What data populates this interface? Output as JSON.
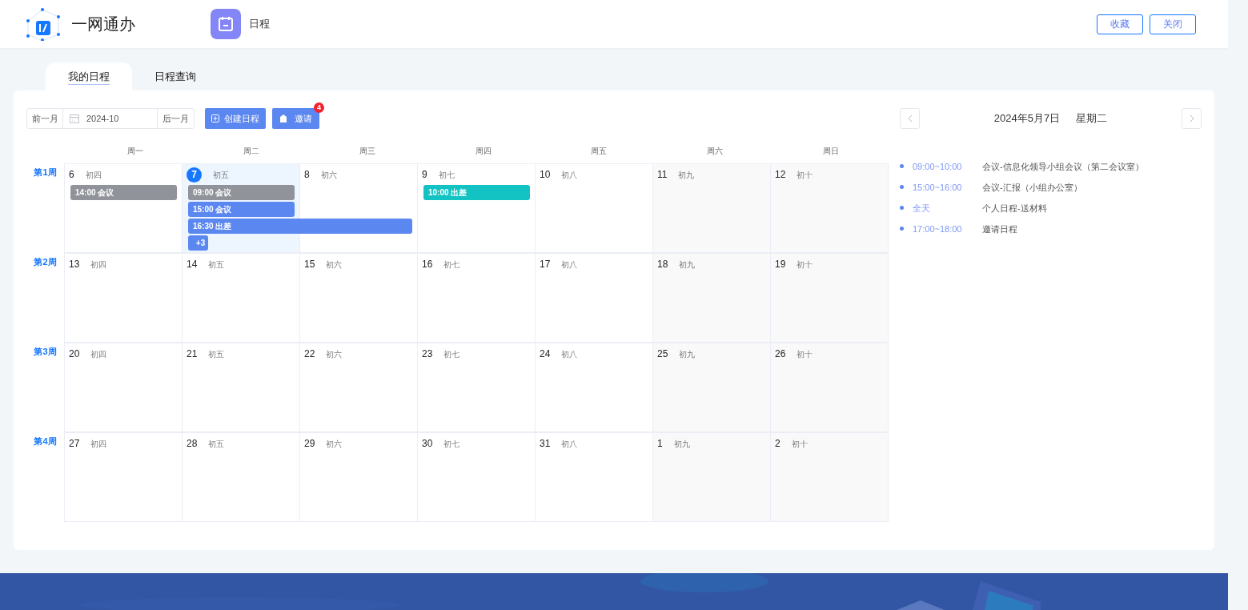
{
  "header": {
    "app_name": "一网通办",
    "module": "日程",
    "buttons": [
      "收藏",
      "关闭"
    ]
  },
  "tabs": [
    {
      "label": "我的日程",
      "selected": true
    },
    {
      "label": "日程查询",
      "selected": false
    }
  ],
  "toolbar": {
    "prev": "前一月",
    "month": "2024-10",
    "next": "后一月",
    "create": "创建日程",
    "invite": "邀请",
    "invite_badge": "4"
  },
  "weekdays": [
    "周一",
    "周二",
    "周三",
    "周四",
    "周五",
    "周六",
    "周日"
  ],
  "weeks": [
    {
      "label": "第1周",
      "days": [
        {
          "date": "6",
          "lunar": "初四",
          "selected": false,
          "events": [
            {
              "kind": "event",
              "label": "14:00 会议",
              "color": "#909399"
            }
          ]
        },
        {
          "date": "7",
          "lunar": "初五",
          "selected": true,
          "events": [
            {
              "kind": "event",
              "label": "09:00 会议",
              "color": "#909399"
            },
            {
              "kind": "event",
              "label": "15:00 会议",
              "color": "#5b87f0"
            },
            {
              "kind": "event",
              "label": "16:30 出差",
              "color": "#5b87f0",
              "continues": true
            },
            {
              "kind": "more",
              "label": "+3",
              "color": "#5b87f0"
            }
          ]
        },
        {
          "date": "8",
          "lunar": "初六",
          "selected": false
        },
        {
          "date": "9",
          "lunar": "初七",
          "selected": false,
          "events": [
            {
              "kind": "event",
              "label": "10:00 出差",
              "color": "#13c2c2"
            }
          ]
        },
        {
          "date": "10",
          "lunar": "初八",
          "selected": false
        },
        {
          "date": "11",
          "lunar": "初九",
          "selected": false
        },
        {
          "date": "12",
          "lunar": "初十",
          "selected": false
        }
      ]
    },
    {
      "label": "第2周",
      "days": [
        {
          "date": "13",
          "lunar": "初四",
          "selected": false
        },
        {
          "date": "14",
          "lunar": "初五",
          "selected": false
        },
        {
          "date": "15",
          "lunar": "初六",
          "selected": false
        },
        {
          "date": "16",
          "lunar": "初七",
          "selected": false
        },
        {
          "date": "17",
          "lunar": "初八",
          "selected": false
        },
        {
          "date": "18",
          "lunar": "初九",
          "selected": false
        },
        {
          "date": "19",
          "lunar": "初十",
          "selected": false
        }
      ]
    },
    {
      "label": "第3周",
      "days": [
        {
          "date": "20",
          "lunar": "初四",
          "selected": false
        },
        {
          "date": "21",
          "lunar": "初五",
          "selected": false
        },
        {
          "date": "22",
          "lunar": "初六",
          "selected": false
        },
        {
          "date": "23",
          "lunar": "初七",
          "selected": false
        },
        {
          "date": "24",
          "lunar": "初八",
          "selected": false
        },
        {
          "date": "25",
          "lunar": "初九",
          "selected": false
        },
        {
          "date": "26",
          "lunar": "初十",
          "selected": false
        }
      ]
    },
    {
      "label": "第4周",
      "days": [
        {
          "date": "27",
          "lunar": "初四",
          "selected": false
        },
        {
          "date": "28",
          "lunar": "初五",
          "selected": false
        },
        {
          "date": "29",
          "lunar": "初六",
          "selected": false
        },
        {
          "date": "30",
          "lunar": "初七",
          "selected": false
        },
        {
          "date": "31",
          "lunar": "初八",
          "selected": false
        },
        {
          "date": "1",
          "lunar": "初九",
          "selected": false
        },
        {
          "date": "2",
          "lunar": "初十",
          "selected": false
        }
      ]
    }
  ],
  "agenda": {
    "date": "2024年5月7日",
    "weekday": "星期二",
    "items": [
      {
        "time": "09:00~10:00",
        "title": "会议-信息化领导小组会议（第二会议室）"
      },
      {
        "time": "15:00~16:00",
        "title": "会议-汇报（小组办公室）"
      },
      {
        "time": "全天",
        "title": "个人日程-送材料"
      },
      {
        "time": "17:00~18:00",
        "title": "邀请日程"
      }
    ]
  }
}
